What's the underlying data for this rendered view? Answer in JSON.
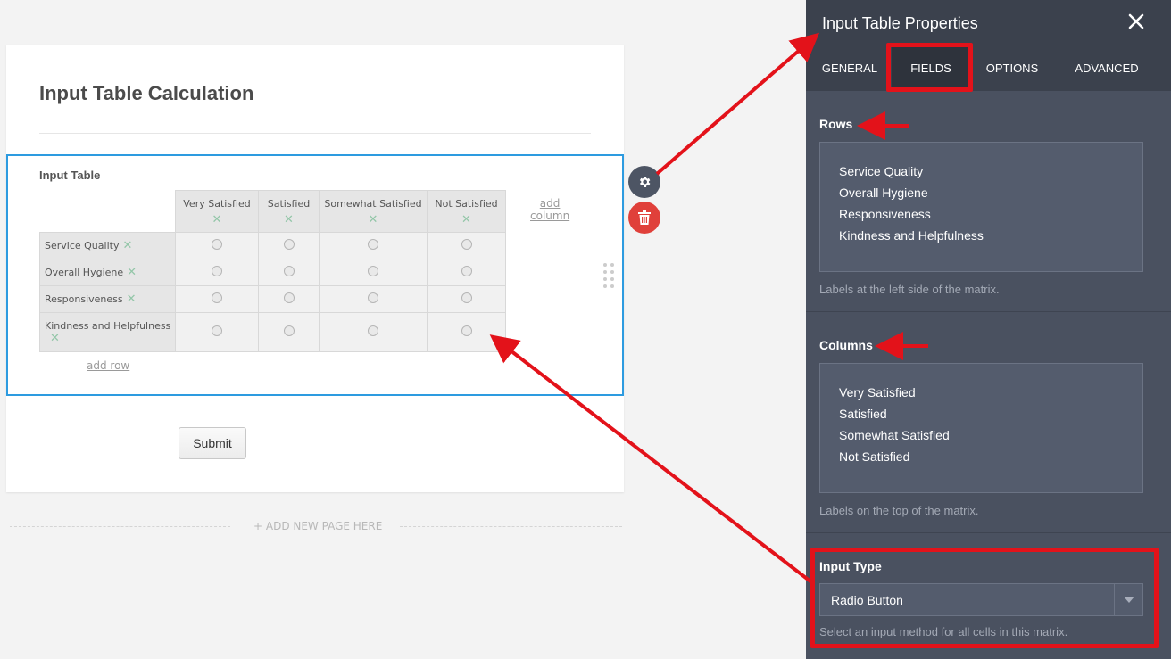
{
  "form": {
    "title": "Input Table Calculation",
    "field_label": "Input Table",
    "columns": [
      "Very Satisfied",
      "Satisfied",
      "Somewhat Satisfied",
      "Not Satisfied"
    ],
    "rows": [
      "Service Quality",
      "Overall Hygiene",
      "Responsiveness",
      "Kindness and Helpfulness"
    ],
    "add_column_line1": "add",
    "add_column_line2": "column",
    "add_row": "add row",
    "submit_label": "Submit",
    "add_new_page": "+ ADD NEW PAGE HERE"
  },
  "panel": {
    "title": "Input Table Properties",
    "tabs": [
      "GENERAL",
      "FIELDS",
      "OPTIONS",
      "ADVANCED"
    ],
    "active_tab": "FIELDS",
    "rows_label": "Rows",
    "rows_values": [
      "Service Quality",
      "Overall Hygiene",
      "Responsiveness",
      "Kindness and Helpfulness"
    ],
    "rows_help": "Labels at the left side of the matrix.",
    "columns_label": "Columns",
    "columns_values": [
      "Very Satisfied",
      "Satisfied",
      "Somewhat Satisfied",
      "Not Satisfied"
    ],
    "columns_help": "Labels on the top of the matrix.",
    "input_type_label": "Input Type",
    "input_type_value": "Radio Button",
    "input_type_help": "Select an input method for all cells in this matrix."
  },
  "icons": {
    "gear": "gear-icon",
    "trash": "trash-icon",
    "close": "close-icon",
    "dropdown": "chevron-down-icon",
    "delete_mark": "x-icon"
  },
  "colors": {
    "selection_border": "#2d9be0",
    "annotation_red": "#e3121a",
    "panel_bg": "#4a5160",
    "trash_red": "#e0403a"
  }
}
